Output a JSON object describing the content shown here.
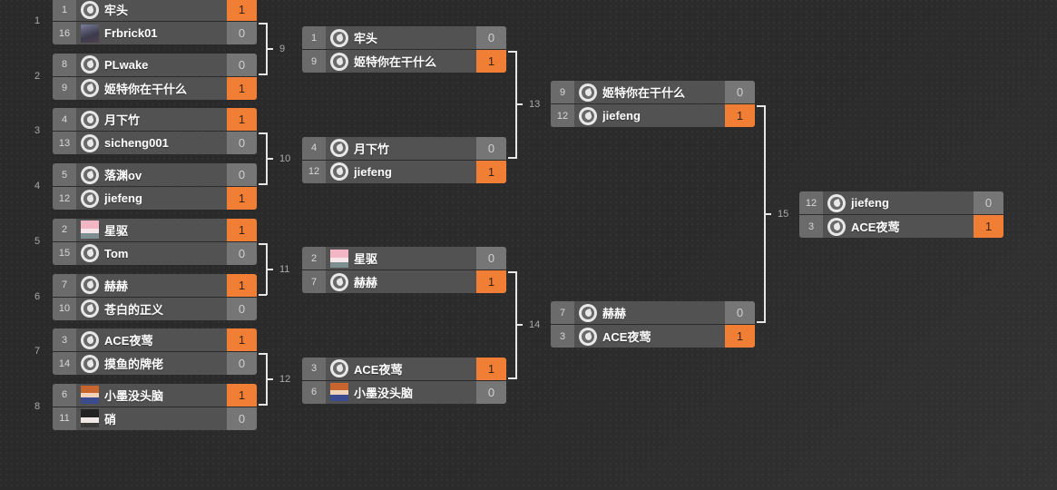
{
  "colors": {
    "win": "#f07f35",
    "score": "#767676",
    "row": "#525252",
    "seed": "#6b6b6b"
  },
  "round1_labels": [
    "1",
    "2",
    "3",
    "4",
    "5",
    "6",
    "7",
    "8"
  ],
  "rounds": [
    [
      {
        "id": "1",
        "players": [
          {
            "seed": "1",
            "name": "牢头",
            "avatar": "logo",
            "score": "1",
            "win": true
          },
          {
            "seed": "16",
            "name": "Frbrick01",
            "avatar": "photo-dark",
            "score": "0",
            "win": false
          }
        ]
      },
      {
        "id": "2",
        "players": [
          {
            "seed": "8",
            "name": "PLwake",
            "avatar": "logo",
            "score": "0",
            "win": false
          },
          {
            "seed": "9",
            "name": "姬特你在干什么",
            "avatar": "logo",
            "score": "1",
            "win": true
          }
        ]
      },
      {
        "id": "3",
        "players": [
          {
            "seed": "4",
            "name": "月下竹",
            "avatar": "logo",
            "score": "1",
            "win": true
          },
          {
            "seed": "13",
            "name": "sicheng001",
            "avatar": "logo",
            "score": "0",
            "win": false
          }
        ]
      },
      {
        "id": "4",
        "players": [
          {
            "seed": "5",
            "name": "落渊ov",
            "avatar": "logo",
            "score": "0",
            "win": false
          },
          {
            "seed": "12",
            "name": "jiefeng",
            "avatar": "logo",
            "score": "1",
            "win": true
          }
        ]
      },
      {
        "id": "5",
        "players": [
          {
            "seed": "2",
            "name": "星驱",
            "avatar": "photo-pink",
            "score": "1",
            "win": true
          },
          {
            "seed": "15",
            "name": "Tom",
            "avatar": "logo",
            "score": "0",
            "win": false
          }
        ]
      },
      {
        "id": "6",
        "players": [
          {
            "seed": "7",
            "name": "赫赫",
            "avatar": "logo",
            "score": "1",
            "win": true
          },
          {
            "seed": "10",
            "name": "苍白的正义",
            "avatar": "logo",
            "score": "0",
            "win": false
          }
        ]
      },
      {
        "id": "7",
        "players": [
          {
            "seed": "3",
            "name": "ACE夜莺",
            "avatar": "logo",
            "score": "1",
            "win": true
          },
          {
            "seed": "14",
            "name": "摸鱼的牌佬",
            "avatar": "logo",
            "score": "0",
            "win": false
          }
        ]
      },
      {
        "id": "8",
        "players": [
          {
            "seed": "6",
            "name": "小墨没头脑",
            "avatar": "photo-anime",
            "score": "1",
            "win": true
          },
          {
            "seed": "11",
            "name": "硝",
            "avatar": "photo-bw",
            "score": "0",
            "win": false
          }
        ]
      }
    ],
    [
      {
        "id": "9",
        "players": [
          {
            "seed": "1",
            "name": "牢头",
            "avatar": "logo",
            "score": "0",
            "win": false
          },
          {
            "seed": "9",
            "name": "姬特你在干什么",
            "avatar": "logo",
            "score": "1",
            "win": true
          }
        ]
      },
      {
        "id": "10",
        "players": [
          {
            "seed": "4",
            "name": "月下竹",
            "avatar": "logo",
            "score": "0",
            "win": false
          },
          {
            "seed": "12",
            "name": "jiefeng",
            "avatar": "logo",
            "score": "1",
            "win": true
          }
        ]
      },
      {
        "id": "11",
        "players": [
          {
            "seed": "2",
            "name": "星驱",
            "avatar": "photo-pink",
            "score": "0",
            "win": false
          },
          {
            "seed": "7",
            "name": "赫赫",
            "avatar": "logo",
            "score": "1",
            "win": true
          }
        ]
      },
      {
        "id": "12",
        "players": [
          {
            "seed": "3",
            "name": "ACE夜莺",
            "avatar": "logo",
            "score": "1",
            "win": true
          },
          {
            "seed": "6",
            "name": "小墨没头脑",
            "avatar": "photo-anime",
            "score": "0",
            "win": false
          }
        ]
      }
    ],
    [
      {
        "id": "13",
        "players": [
          {
            "seed": "9",
            "name": "姬特你在干什么",
            "avatar": "logo",
            "score": "0",
            "win": false
          },
          {
            "seed": "12",
            "name": "jiefeng",
            "avatar": "logo",
            "score": "1",
            "win": true
          }
        ]
      },
      {
        "id": "14",
        "players": [
          {
            "seed": "7",
            "name": "赫赫",
            "avatar": "logo",
            "score": "0",
            "win": false
          },
          {
            "seed": "3",
            "name": "ACE夜莺",
            "avatar": "logo",
            "score": "1",
            "win": true
          }
        ]
      }
    ],
    [
      {
        "id": "15",
        "players": [
          {
            "seed": "12",
            "name": "jiefeng",
            "avatar": "logo",
            "score": "0",
            "win": false
          },
          {
            "seed": "3",
            "name": "ACE夜莺",
            "avatar": "logo",
            "score": "1",
            "win": true
          }
        ]
      }
    ]
  ]
}
